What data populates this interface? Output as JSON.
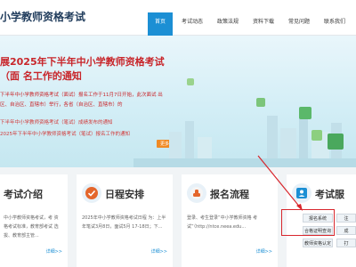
{
  "header": {
    "site_title": "小学教师资格考试",
    "nav": [
      "首页",
      "考试动态",
      "政策法规",
      "资料下载",
      "常见问题",
      "联系我们"
    ]
  },
  "banner": {
    "title": "展2025年下半年中小学教师资格考试（面 名工作的通知",
    "text": "下半年中小学教师资格考试（面试）报名工作于11月7日开始，此次面试 出区、自治区、直辖市）举行，各省（自治区、直辖市）的",
    "link1": "下半年中小学教师资格考试（笔试）成绩发布的通知",
    "link2": "2025年下半年中小学教师资格考试（笔试）报名工作的通知",
    "more": "更多>>"
  },
  "cards": [
    {
      "title": "考试介绍",
      "text": "中小学教师资格考试，考 资格考试标准，教育部考试 选拔、教育部主管...",
      "more": "详细>>",
      "icon": "book-icon"
    },
    {
      "title": "日程安排",
      "text": "2025年中小学教师资格考试日程 为：上半年笔试3月8日，面试5月 17-18日；下...",
      "more": "详细>>",
      "icon": "check-circle-icon"
    },
    {
      "title": "报名流程",
      "text": "登录、考生登录“中小学教师资格 考试”（http://ntce.neea.edu...",
      "more": "详细>>",
      "icon": "hand-icon"
    },
    {
      "title": "考试服",
      "icon": "person-icon"
    }
  ],
  "service_buttons": [
    "报名系统",
    "注",
    "合格证明查询",
    "成",
    "教师资格认定",
    "打"
  ],
  "colors": {
    "accent": "#1c8fd4",
    "highlight": "#d8262c",
    "banner_text": "#c8252a"
  }
}
